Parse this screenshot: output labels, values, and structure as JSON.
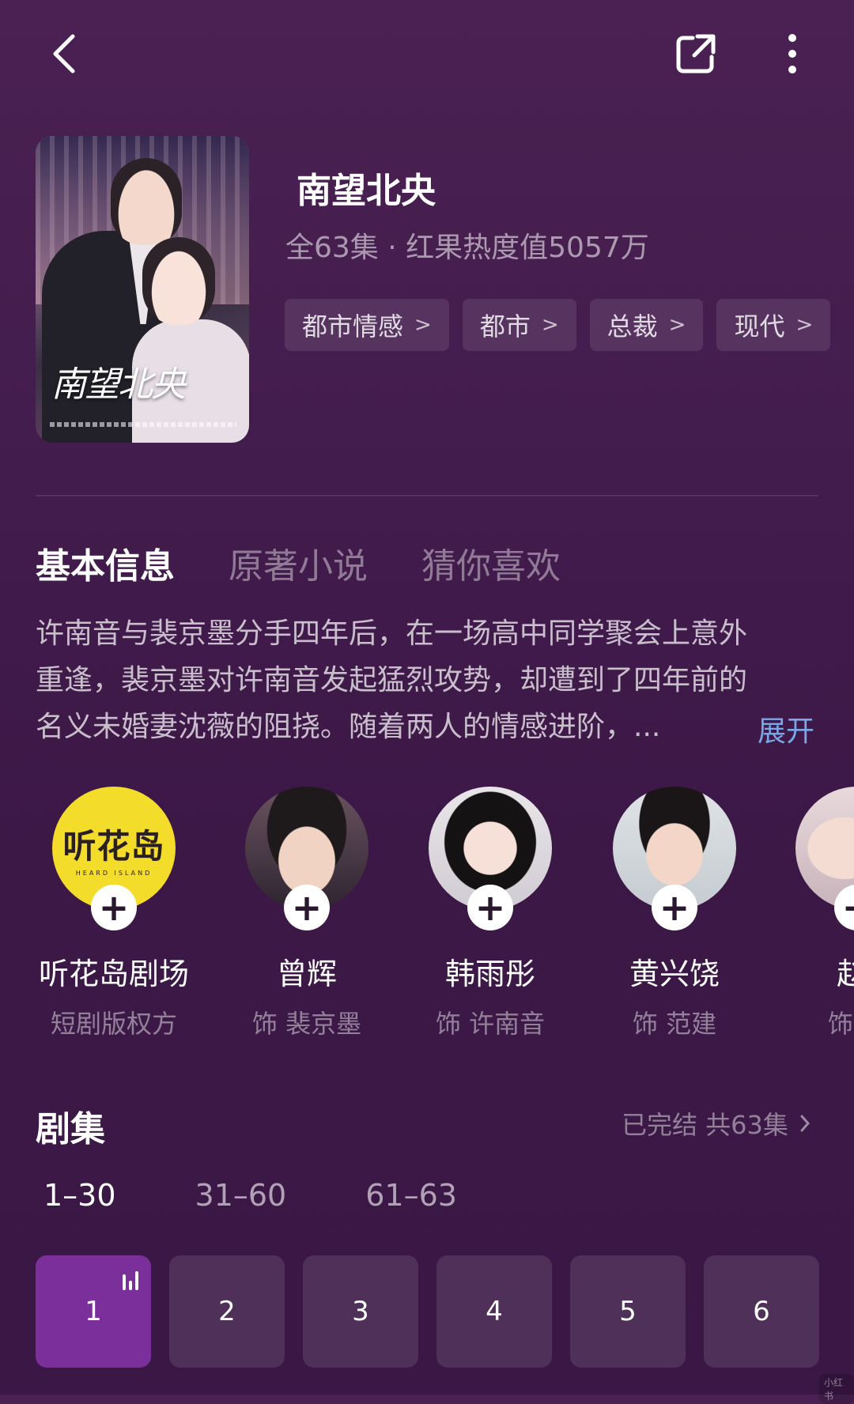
{
  "topbar": {
    "back_icon": "chevron-left-icon",
    "share_icon": "share-icon",
    "more_icon": "more-vertical-icon"
  },
  "drama": {
    "title": "南望北央",
    "subtitle": "全63集 · 红果热度值5057万",
    "poster_text": "南望北央",
    "tags": [
      "都市情感",
      "都市",
      "总裁",
      "现代"
    ]
  },
  "tabs": [
    {
      "label": "基本信息",
      "active": true
    },
    {
      "label": "原著小说",
      "active": false
    },
    {
      "label": "猜你喜欢",
      "active": false
    }
  ],
  "description": {
    "lines": [
      "许南音与裴京墨分手四年后，在一场高中同学聚会上意外",
      "重逢，裴京墨对许南音发起猛烈攻势，却遭到了四年前的",
      "名义未婚妻沈薇的阻挠。随着两人的情感进阶，..."
    ],
    "expand": "展开"
  },
  "cast": [
    {
      "name": "听花岛剧场",
      "role": "短剧版权方",
      "logo_text": "听花岛",
      "logo_sub": "HEARD ISLAND"
    },
    {
      "name": "曾辉",
      "role": "饰 裴京墨"
    },
    {
      "name": "韩雨彤",
      "role": "饰 许南音"
    },
    {
      "name": "黄兴饶",
      "role": "饰 范建"
    },
    {
      "name": "赵-",
      "role": "饰 沈"
    }
  ],
  "episodes": {
    "title": "剧集",
    "status": "已完结 共63集",
    "ranges": [
      {
        "label": "1–30",
        "active": true
      },
      {
        "label": "31–60",
        "active": false
      },
      {
        "label": "61–63",
        "active": false
      }
    ],
    "items": [
      "1",
      "2",
      "3",
      "4",
      "5",
      "6"
    ],
    "active": "1"
  },
  "watermark": "小红书",
  "colors": {
    "background": "#431d4d",
    "accent": "#7a2f9a",
    "link": "#7ba6e8",
    "logo_yellow": "#f3dc2a"
  }
}
